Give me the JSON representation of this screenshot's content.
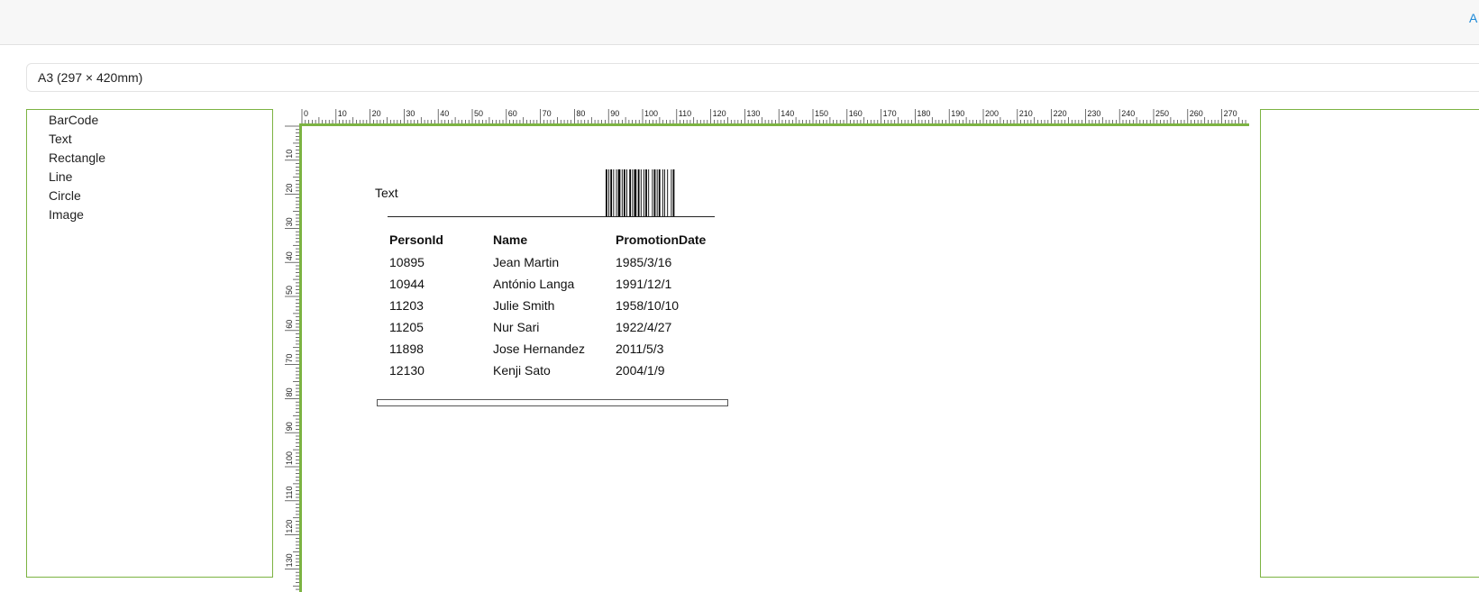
{
  "topbar": {
    "link_label": "A"
  },
  "paper": {
    "selected": "A3 (297 × 420mm)"
  },
  "toolbox": {
    "items": [
      {
        "label": "BarCode"
      },
      {
        "label": "Text"
      },
      {
        "label": "Rectangle"
      },
      {
        "label": "Line"
      },
      {
        "label": "Circle"
      },
      {
        "label": "Image"
      }
    ]
  },
  "ruler": {
    "top_labels": [
      "0",
      "10",
      "20",
      "30",
      "40",
      "50",
      "60",
      "70",
      "80",
      "90",
      "100",
      "110",
      "120",
      "130",
      "140",
      "150",
      "160",
      "170",
      "180",
      "190",
      "200",
      "210",
      "220",
      "230",
      "240",
      "250",
      "260",
      "270"
    ],
    "left_labels": [
      "10",
      "20",
      "30",
      "40",
      "50",
      "60",
      "70",
      "80",
      "90",
      "100",
      "110",
      "120",
      "130"
    ]
  },
  "canvas": {
    "text_element": "Text",
    "table": {
      "headers": [
        "PersonId",
        "Name",
        "PromotionDate"
      ],
      "rows": [
        [
          "10895",
          "Jean Martin",
          "1985/3/16"
        ],
        [
          "10944",
          "António Langa",
          "1991/12/1"
        ],
        [
          "11203",
          "Julie Smith",
          "1958/10/10"
        ],
        [
          "11205",
          "Nur Sari",
          "1922/4/27"
        ],
        [
          "11898",
          "Jose Hernandez",
          "2011/5/3"
        ],
        [
          "12130",
          "Kenji Sato",
          "2004/1/9"
        ]
      ]
    }
  },
  "colors": {
    "panel_border": "#7cb342",
    "link": "#1a88d8"
  }
}
